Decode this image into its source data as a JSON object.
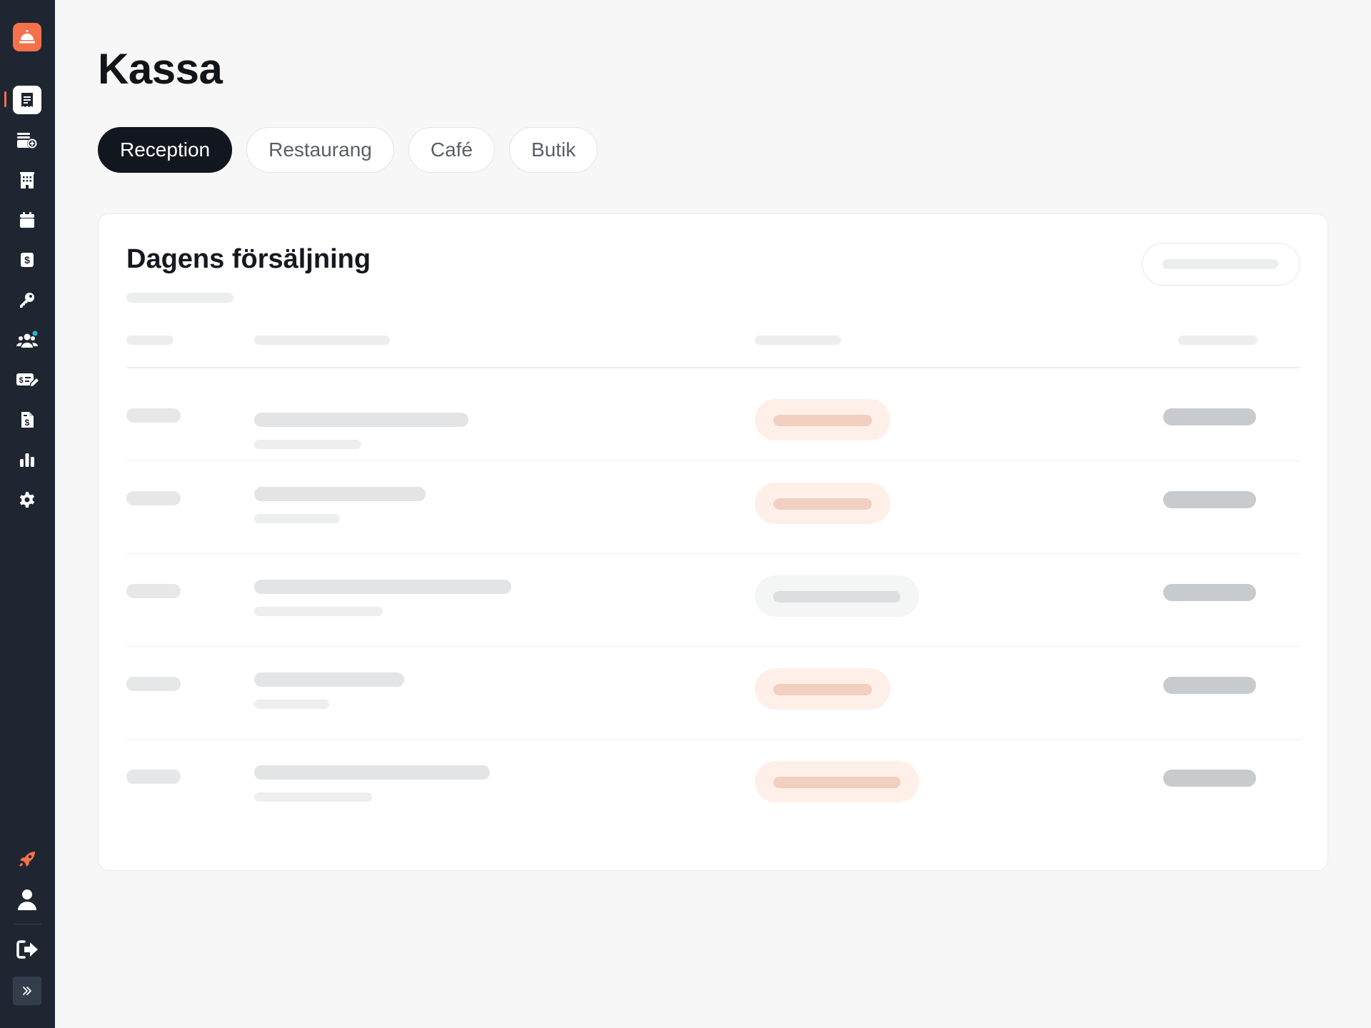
{
  "page": {
    "title": "Kassa"
  },
  "tabs": [
    {
      "label": "Reception",
      "active": true
    },
    {
      "label": "Restaurang",
      "active": false
    },
    {
      "label": "Café",
      "active": false
    },
    {
      "label": "Butik",
      "active": false
    }
  ],
  "card": {
    "title": "Dagens försäljning"
  },
  "sidebar": {
    "logo_icon": "bell-icon",
    "items": [
      {
        "icon": "receipt-icon",
        "active": true
      },
      {
        "icon": "coins-add-icon",
        "active": false
      },
      {
        "icon": "building-icon",
        "active": false
      },
      {
        "icon": "calendar-icon",
        "active": false
      },
      {
        "icon": "dollar-bill-icon",
        "active": false
      },
      {
        "icon": "key-icon",
        "active": false
      },
      {
        "icon": "users-icon",
        "active": false
      },
      {
        "icon": "payment-edit-icon",
        "active": false
      },
      {
        "icon": "invoice-icon",
        "active": false
      },
      {
        "icon": "bar-chart-icon",
        "active": false
      },
      {
        "icon": "gear-icon",
        "active": false
      }
    ],
    "bottom_items": [
      "rocket-icon",
      "user-icon",
      "logout-icon",
      "expand-icon"
    ]
  },
  "colors": {
    "accent": "#f4714c",
    "sidebar_bg": "#1f2632",
    "active_tab_bg": "#12171f",
    "page_bg": "#f6f7f6",
    "badge_orange_bg": "#fef0e9",
    "badge_orange_bar": "#f2cfc1",
    "badge_gray_bg": "#f4f5f5",
    "badge_gray_bar": "#dcdee0"
  },
  "table": {
    "loading": true,
    "rows": [
      {
        "status": "orange"
      },
      {
        "status": "orange"
      },
      {
        "status": "gray"
      },
      {
        "status": "orange"
      },
      {
        "status": "orange"
      }
    ]
  }
}
